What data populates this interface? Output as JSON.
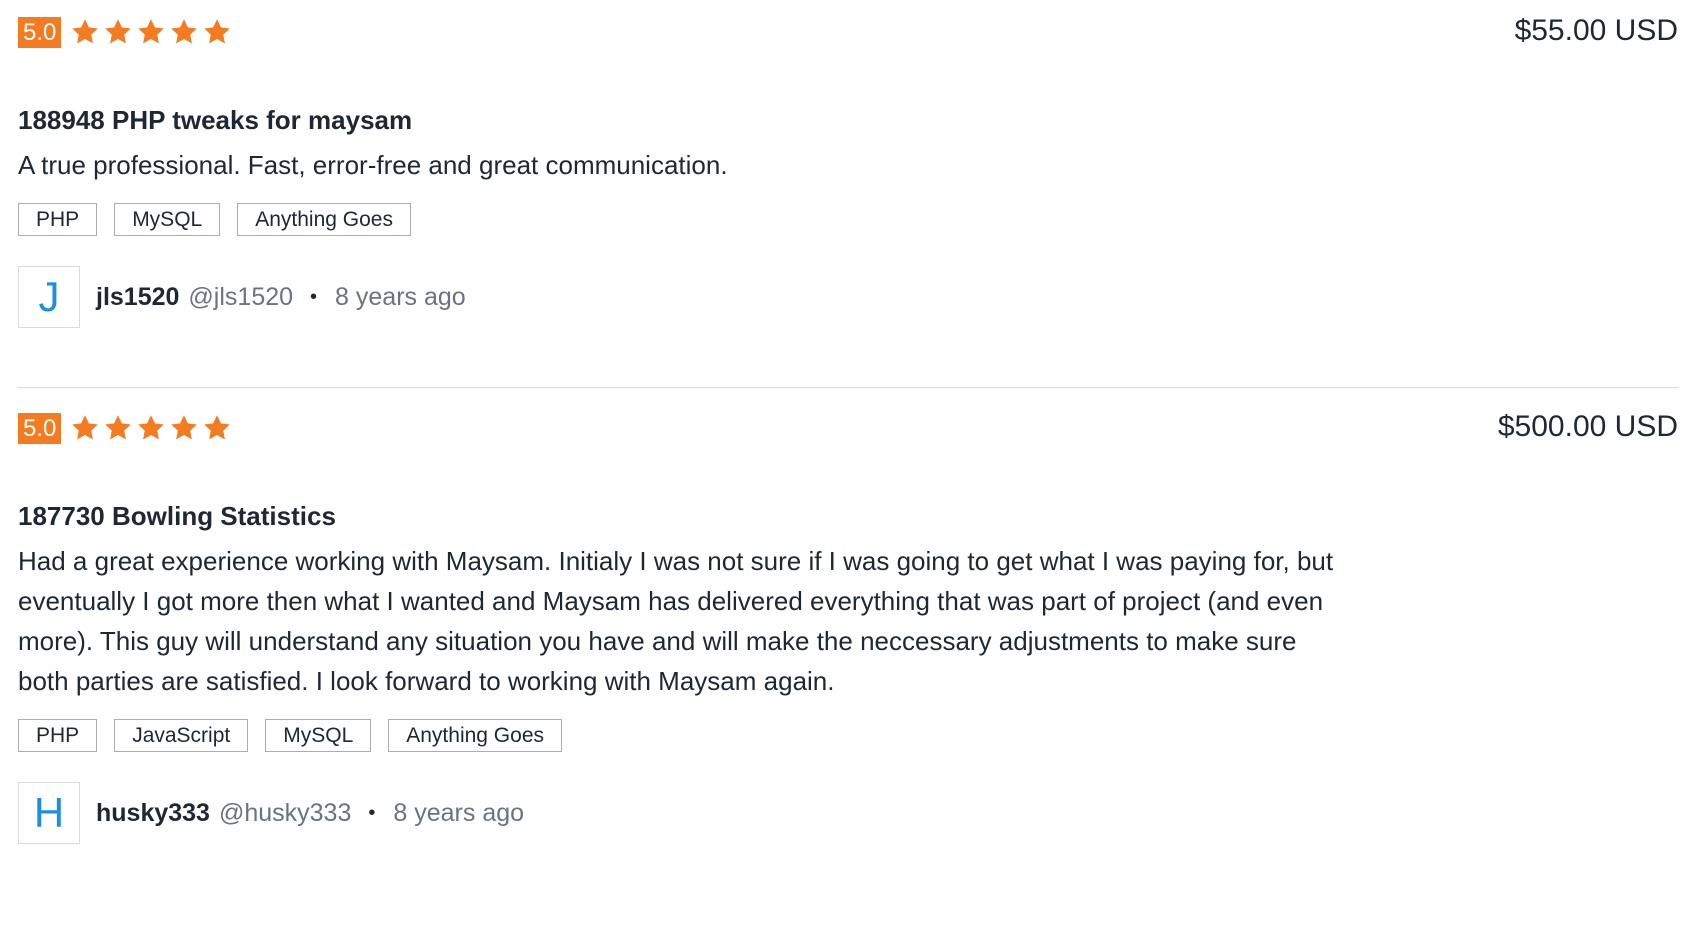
{
  "colors": {
    "accent": "#f47b20",
    "link_blue": "#1c8ee6",
    "text": "#1f2733",
    "muted": "#6b7280",
    "divider": "#d9dbde"
  },
  "reviews": [
    {
      "rating": "5.0",
      "stars": 5,
      "price": "$55.00 USD",
      "title": "188948 PHP tweaks for maysam",
      "comment": "A true professional. Fast, error-free and great communication.",
      "tags": [
        "PHP",
        "MySQL",
        "Anything Goes"
      ],
      "avatar_letter": "J",
      "username": "jls1520",
      "handle": "@jls1520",
      "separator": "•",
      "time": "8 years ago"
    },
    {
      "rating": "5.0",
      "stars": 5,
      "price": "$500.00 USD",
      "title": "187730 Bowling Statistics",
      "comment": "Had a great experience working with Maysam. Initialy I was not sure if I was going to get what I was paying for, but eventually I got more then what I wanted and Maysam has delivered everything that was part of project (and even more). This guy will understand any situation you have and will make the neccessary adjustments to make sure both parties are satisfied. I look forward to working with Maysam again.",
      "tags": [
        "PHP",
        "JavaScript",
        "MySQL",
        "Anything Goes"
      ],
      "avatar_letter": "H",
      "username": "husky333",
      "handle": "@husky333",
      "separator": "•",
      "time": "8 years ago"
    }
  ]
}
